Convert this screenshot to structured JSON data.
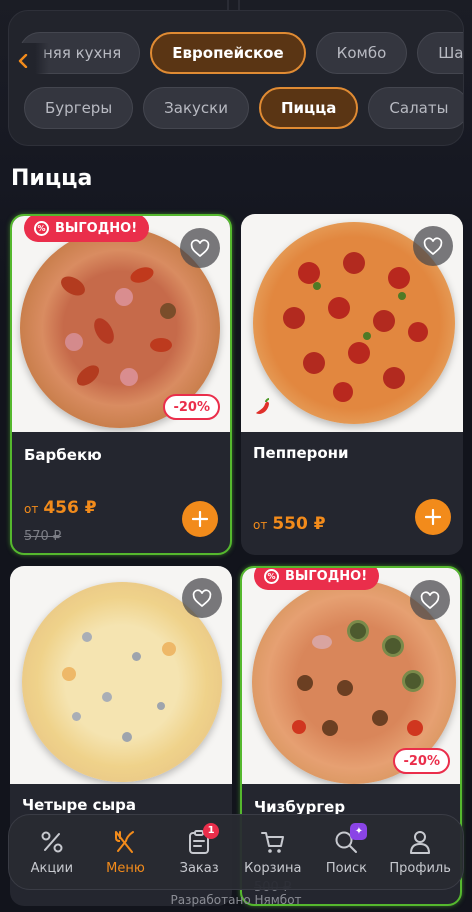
{
  "categories_row1": [
    "няя кухня",
    "Европейское",
    "Комбо",
    "Шавер"
  ],
  "categories_row2": [
    "Бургеры",
    "Закуски",
    "Пицца",
    "Салаты"
  ],
  "active_category": "Пицца",
  "active_cuisine": "Европейское",
  "section_title": "Пицца",
  "products": [
    {
      "name": "Барбекю",
      "price_prefix": "от",
      "price": "456 ₽",
      "old_price": "570 ₽",
      "promo_badge": "ВЫГОДНО!",
      "discount": "-20%"
    },
    {
      "name": "Пепперони",
      "price_prefix": "от",
      "price": "550 ₽"
    },
    {
      "name": "Четыре сыра"
    },
    {
      "name": "Чизбургер",
      "old_price": "500 ₽",
      "promo_badge": "ВЫГОДНО!",
      "discount": "-20%"
    }
  ],
  "tabbar": [
    {
      "label": "Акции",
      "icon": "percent-icon"
    },
    {
      "label": "Меню",
      "icon": "fork-knife-icon",
      "active": true
    },
    {
      "label": "Заказ",
      "icon": "order-clipboard-icon",
      "badge": "1"
    },
    {
      "label": "Корзина",
      "icon": "cart-icon"
    },
    {
      "label": "Поиск",
      "icon": "search-icon"
    },
    {
      "label": "Профиль",
      "icon": "profile-icon"
    }
  ],
  "footer_text": "Разработано Нямбот",
  "colors": {
    "accent": "#f28b1b",
    "promo": "#ea2e4b",
    "promo_border": "#55b82e",
    "background": "#12141c"
  }
}
